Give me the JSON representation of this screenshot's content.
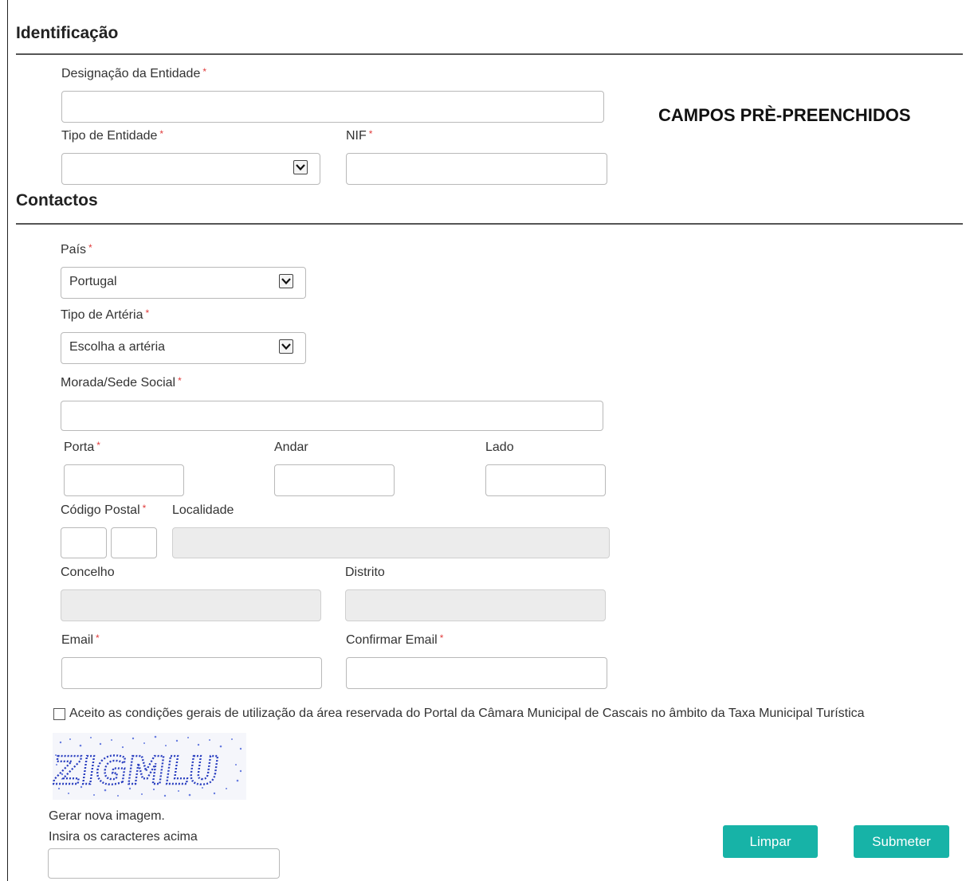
{
  "required_marker": "*",
  "identificacao": {
    "title": "Identificação",
    "designacao_label": "Designação da Entidade",
    "tipo_entidade_label": "Tipo de Entidade",
    "tipo_entidade_value": "",
    "nif_label": "NIF",
    "prefilled_note": "CAMPOS PRÈ-PREENCHIDOS"
  },
  "contactos": {
    "title": "Contactos",
    "pais_label": "País",
    "pais_value": "Portugal",
    "tipo_arteria_label": "Tipo de Artéria",
    "tipo_arteria_value": "Escolha a artéria",
    "morada_label": "Morada/Sede Social",
    "porta_label": "Porta",
    "andar_label": "Andar",
    "lado_label": "Lado",
    "codigo_postal_label": "Código Postal",
    "localidade_label": "Localidade",
    "concelho_label": "Concelho",
    "distrito_label": "Distrito",
    "email_label": "Email",
    "confirmar_email_label": "Confirmar Email"
  },
  "terms": {
    "checked": false,
    "text": "Aceito as condições gerais de utilização da área reservada do Portal da Câmara Municipal de Cascais no âmbito da Taxa Municipal Turística"
  },
  "captcha": {
    "image_text": "ZIGMLU",
    "regenerate_label": "Gerar nova imagem.",
    "input_label": "Insira os caracteres acima"
  },
  "buttons": {
    "clear_label": "Limpar",
    "submit_label": "Submeter"
  },
  "colors": {
    "accent": "#17b3a7",
    "required": "#e03b3b",
    "captcha_text": "#2a3fc0"
  }
}
